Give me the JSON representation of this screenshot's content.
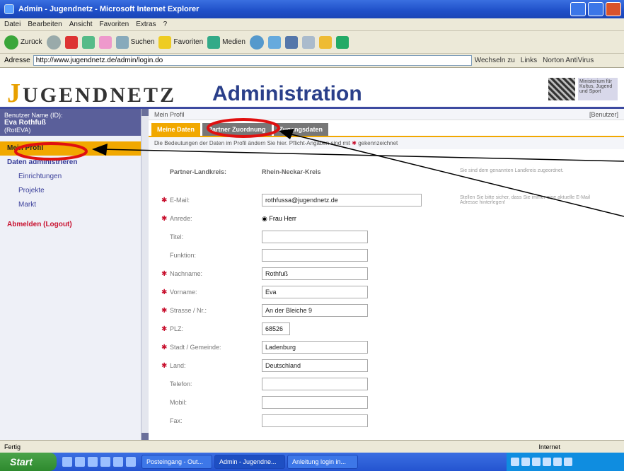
{
  "window": {
    "title": "Admin - Jugendnetz - Microsoft Internet Explorer"
  },
  "menu": [
    "Datei",
    "Bearbeiten",
    "Ansicht",
    "Favoriten",
    "Extras",
    "?"
  ],
  "toolbar": {
    "back": "Zurück",
    "search": "Suchen",
    "favorites": "Favoriten",
    "media": "Medien"
  },
  "address": {
    "label": "Adresse",
    "url": "http://www.jugendnetz.de/admin/login.do",
    "go": "Wechseln zu",
    "links": "Links",
    "norton": "Norton AntiVirus"
  },
  "header": {
    "logo": "UGENDNETZ",
    "logo_j": "J",
    "title": "Administration",
    "crest_text": "Ministerium für Kultus, Jugend und Sport"
  },
  "sidebar": {
    "user_label": "Benutzer Name (ID):",
    "user_name": "Eva Rothfuß",
    "user_id": "(RotEVA)",
    "items": [
      {
        "label": "Mein Profil",
        "active": true
      },
      {
        "label": "Daten administrieren",
        "active": false
      },
      {
        "label": "Einrichtungen",
        "active": false
      },
      {
        "label": "Projekte",
        "active": false
      },
      {
        "label": "Markt",
        "active": false
      },
      {
        "label": "Abmelden (Logout)",
        "active": false
      }
    ]
  },
  "main": {
    "breadcrumb": "Mein Profil",
    "breadcrumb_right": "[Benutzer]",
    "tabs": [
      {
        "label": "Meine Daten",
        "active": true
      },
      {
        "label": "Partner Zuordnung",
        "active": false
      },
      {
        "label": "Zugangsdaten",
        "active": false
      }
    ],
    "notice": "Die Bedeutungen der Daten im Profil ändern Sie hier. Pflicht-Angaben sind mit",
    "notice_star": "✱",
    "notice_end": "gekennzeichnet",
    "partner_label": "Partner-Landkreis:",
    "partner_value": "Rhein-Neckar-Kreis",
    "partner_hint": "Sie sind dem genannten Landkreis zugeordnet.",
    "email_hint": "Stellen Sie bitte sicher, dass Sie immer eine aktuelle E-Mail Adresse hinterlegen!",
    "fields": [
      {
        "label": "E-Mail:",
        "value": "rothfussa@jugendnetz.de",
        "required": true
      },
      {
        "label": "Anrede:",
        "value": "Frau  Herr",
        "required": true
      },
      {
        "label": "Titel:",
        "value": "",
        "required": false
      },
      {
        "label": "Funktion:",
        "value": "",
        "required": false
      },
      {
        "label": "Nachname:",
        "value": "Rothfuß",
        "required": true
      },
      {
        "label": "Vorname:",
        "value": "Eva",
        "required": true
      },
      {
        "label": "Strasse / Nr.:",
        "value": "An der Bleiche 9",
        "required": true
      },
      {
        "label": "PLZ:",
        "value": "68526",
        "required": true
      },
      {
        "label": "Stadt / Gemeinde:",
        "value": "Ladenburg",
        "required": true
      },
      {
        "label": "Land:",
        "value": "Deutschland",
        "required": true
      },
      {
        "label": "Telefon:",
        "value": "",
        "required": false
      },
      {
        "label": "Mobil:",
        "value": "",
        "required": false
      },
      {
        "label": "Fax:",
        "value": "",
        "required": false
      }
    ]
  },
  "status": {
    "left": "Fertig",
    "zone": "Internet"
  },
  "taskbar": {
    "start": "Start",
    "tasks": [
      "Posteingang - Out...",
      "Admin - Jugendne...",
      "Anleitung login in..."
    ]
  },
  "colors": {
    "accent": "#f1a800",
    "brand": "#2a3f8a",
    "required": "#c8102e",
    "annotation": "#e01010"
  }
}
